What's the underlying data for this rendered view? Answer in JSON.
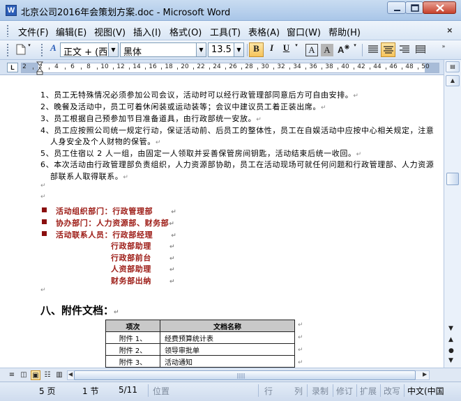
{
  "window": {
    "title": "北京公司2016年会策划方案.doc - Microsoft Word",
    "app_icon_letter": "W"
  },
  "menu": {
    "items": [
      "文件(F)",
      "编辑(E)",
      "视图(V)",
      "插入(I)",
      "格式(O)",
      "工具(T)",
      "表格(A)",
      "窗口(W)",
      "帮助(H)"
    ],
    "close_glyph": "×"
  },
  "toolbar": {
    "style_value": "正文 + (西文",
    "font_value": "黑体",
    "size_value": "13.5",
    "bold": "B",
    "italic": "I",
    "underline": "U",
    "char_border": "A",
    "char_shade": "A",
    "style_icon_letter": "A"
  },
  "ruler": {
    "corner": "L",
    "numbers": [
      "2",
      "2",
      "4",
      "6",
      "8",
      "10",
      "12",
      "14",
      "16",
      "18",
      "20",
      "22",
      "24",
      "26",
      "28",
      "30",
      "32",
      "34",
      "36",
      "38",
      "40",
      "42",
      "44",
      "46",
      "48",
      "50"
    ]
  },
  "document": {
    "list_items": [
      "1、员工无特殊情况必须参加公司会议，活动时可以经行政管理部同意后方可自由安排。",
      "2、晚餐及活动中，员工可着休闲装或运动装等；会议中建议员工着正装出席。",
      "3、员工根据自己预参加节目准备道具，由行政部统一安放。",
      "4、员工应按照公司统一规定行动，保证活动前、后员工的整体性，员工在自娱活动中应按中心相关规定，注意",
      "人身安全及个人财物的保管。",
      "5、员工住宿以 2 人一组，由固定一人领取并妥善保管房间钥匙，活动结束后统一收回。",
      "6、本次活动由行政管理部负责组织，人力资源部协助，员工在活动现场可就任何问题和行政管理部、人力资源",
      "部联系人取得联系。"
    ],
    "paragraph_mark": "↵",
    "org": [
      {
        "label": "活动组织部门：行政管理部"
      },
      {
        "label": "协办部门：人力资源部、财务部"
      },
      {
        "label": "活动联系人员：行政部经理"
      }
    ],
    "contacts_extra": [
      "行政部助理",
      "行政部前台",
      "人资部助理",
      "财务部出纳"
    ],
    "section_heading": "八、附件文档：",
    "table": {
      "headers": [
        "项次",
        "文档名称"
      ],
      "rows": [
        [
          "附件 1、",
          "经费预算统计表"
        ],
        [
          "附件 2、",
          "领导审批单"
        ],
        [
          "附件 3、",
          "活动通知"
        ]
      ]
    }
  },
  "status": {
    "page": "5 页",
    "section": "1 节",
    "page_of": "5/11",
    "position": "位置",
    "line": "行",
    "column": "列",
    "rec": "录制",
    "trk": "修订",
    "ext": "扩展",
    "ovr": "改写",
    "language": "中文(中国"
  }
}
